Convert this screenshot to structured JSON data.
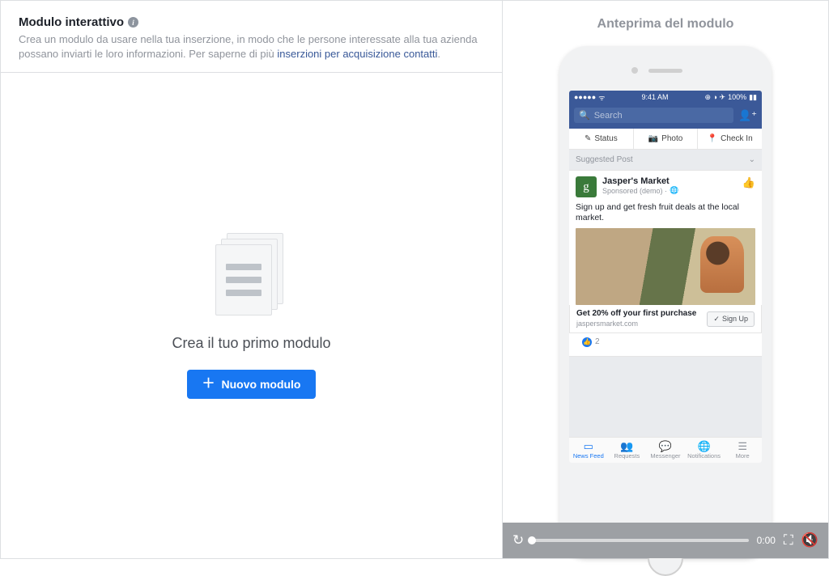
{
  "left": {
    "title": "Modulo interattivo",
    "description": "Crea un modulo da usare nella tua inserzione, in modo che le persone interessate alla tua azienda possano inviarti le loro informazioni. Per saperne di più ",
    "learn_more": "inserzioni per acquisizione contatti",
    "empty_title": "Crea il tuo primo modulo",
    "new_button": "Nuovo modulo"
  },
  "right": {
    "title": "Anteprima del modulo"
  },
  "phone": {
    "status_time": "9:41 AM",
    "status_battery": "100%",
    "search_placeholder": "Search",
    "tabs": {
      "status": "Status",
      "photo": "Photo",
      "checkin": "Check In"
    },
    "suggested_label": "Suggested Post",
    "post": {
      "page_name": "Jasper's Market",
      "sponsored": "Sponsored (demo) ·",
      "body": "Sign up and get fresh fruit deals at the local market.",
      "cta_title": "Get 20% off your first purchase",
      "cta_domain": "jaspersmarket.com",
      "signup": "Sign Up",
      "like_count": "2"
    },
    "nav": {
      "feed": "News Feed",
      "requests": "Requests",
      "messenger": "Messenger",
      "notifications": "Notifications",
      "more": "More"
    }
  },
  "video": {
    "time": "0:00"
  }
}
